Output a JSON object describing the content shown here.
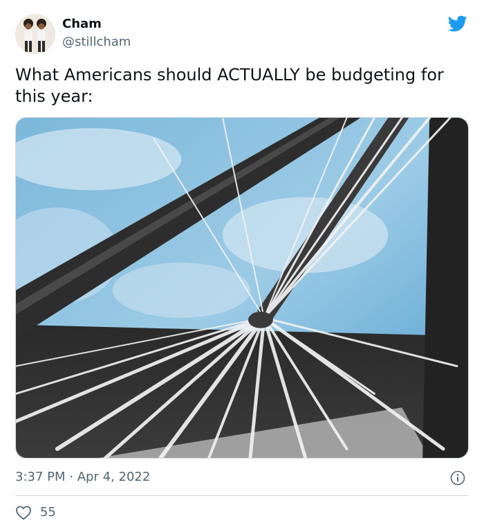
{
  "author": {
    "name": "Cham",
    "handle": "@stillcham"
  },
  "tweet": {
    "text": "What Americans should ACTUALLY be budgeting for this year:",
    "time": "3:37 PM",
    "separator": "·",
    "date": "Apr 4, 2022",
    "likes": "55"
  },
  "icons": {
    "brand": "twitter-bird-icon",
    "info": "info-icon",
    "like": "heart-icon"
  },
  "colors": {
    "brand": "#1d9bf0",
    "text_primary": "#0f1419",
    "text_secondary": "#536471",
    "divider": "#cfd9de"
  }
}
